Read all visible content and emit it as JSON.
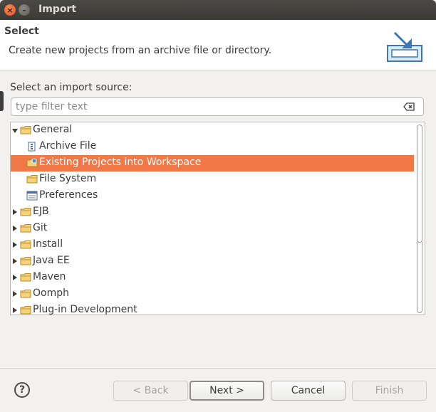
{
  "window": {
    "title": "Import"
  },
  "header": {
    "title": "Select",
    "description": "Create new projects from an archive file or directory."
  },
  "source": {
    "label": "Select an import source:",
    "filter_placeholder": "type filter text",
    "filter_value": ""
  },
  "tree": {
    "items": [
      {
        "label": "General",
        "level": 0,
        "expandable": true,
        "expanded": true,
        "icon": "folder-icon",
        "selected": false
      },
      {
        "label": "Archive File",
        "level": 1,
        "expandable": false,
        "icon": "archive-file-icon",
        "selected": false
      },
      {
        "label": "Existing Projects into Workspace",
        "level": 1,
        "expandable": false,
        "icon": "existing-projects-icon",
        "selected": true
      },
      {
        "label": "File System",
        "level": 1,
        "expandable": false,
        "icon": "folder-icon",
        "selected": false
      },
      {
        "label": "Preferences",
        "level": 1,
        "expandable": false,
        "icon": "preferences-icon",
        "selected": false
      },
      {
        "label": "EJB",
        "level": 0,
        "expandable": true,
        "expanded": false,
        "icon": "folder-icon",
        "selected": false
      },
      {
        "label": "Git",
        "level": 0,
        "expandable": true,
        "expanded": false,
        "icon": "folder-icon",
        "selected": false
      },
      {
        "label": "Install",
        "level": 0,
        "expandable": true,
        "expanded": false,
        "icon": "folder-icon",
        "selected": false
      },
      {
        "label": "Java EE",
        "level": 0,
        "expandable": true,
        "expanded": false,
        "icon": "folder-icon",
        "selected": false
      },
      {
        "label": "Maven",
        "level": 0,
        "expandable": true,
        "expanded": false,
        "icon": "folder-icon",
        "selected": false
      },
      {
        "label": "Oomph",
        "level": 0,
        "expandable": true,
        "expanded": false,
        "icon": "folder-icon",
        "selected": false
      },
      {
        "label": "Plug-in Development",
        "level": 0,
        "expandable": true,
        "expanded": false,
        "icon": "folder-icon",
        "selected": false
      }
    ]
  },
  "footer": {
    "help_label": "?",
    "back_label": "< Back",
    "next_label": "Next >",
    "cancel_label": "Cancel",
    "finish_label": "Finish"
  },
  "colors": {
    "selection": "#f07746",
    "titlebar": "#3c3b37",
    "close_button": "#e95420"
  }
}
